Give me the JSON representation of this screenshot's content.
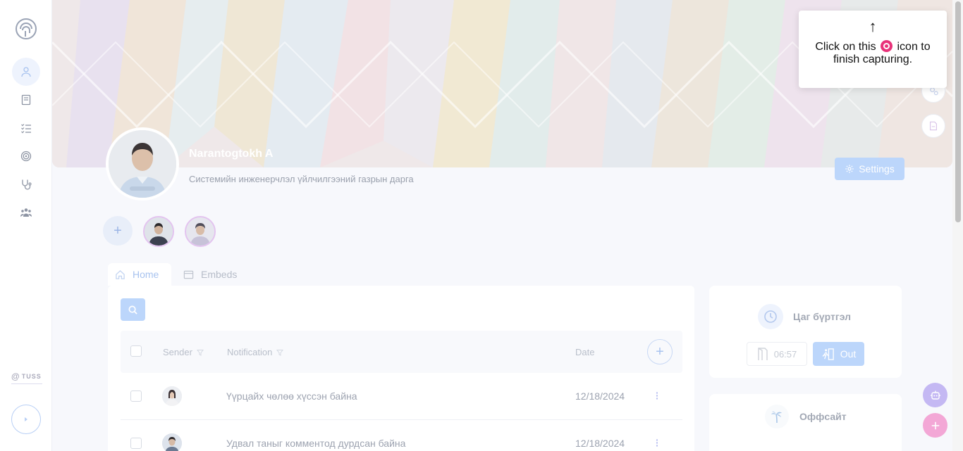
{
  "profile": {
    "name": "Narantogtokh A",
    "job_title": "Системийн инженерчлэл үйлчилгээний газрын дарга",
    "settings_label": "Settings"
  },
  "sidebar": {
    "brand": "TUSS",
    "items": [
      {
        "icon": "user-icon"
      },
      {
        "icon": "book-icon"
      },
      {
        "icon": "checklist-icon"
      },
      {
        "icon": "target-icon"
      },
      {
        "icon": "stethoscope-icon"
      },
      {
        "icon": "team-icon"
      }
    ]
  },
  "tabs": [
    {
      "label": "Home",
      "icon": "home-icon",
      "active": true
    },
    {
      "label": "Embeds",
      "icon": "embed-icon",
      "active": false
    }
  ],
  "table": {
    "columns": {
      "sender": "Sender",
      "notification": "Notification",
      "date": "Date"
    },
    "rows": [
      {
        "text": "Үүрцайх чөлөө хүссэн байна",
        "date": "12/18/2024"
      },
      {
        "text": "Удвал таныг комментод дурдсан байна",
        "date": "12/18/2024"
      }
    ]
  },
  "attendance": {
    "title": "Цаг бүртгэл",
    "time": "06:57",
    "out_label": "Out"
  },
  "offsite": {
    "title": "Оффсайт"
  },
  "tooltip": {
    "arrow": "↑",
    "text_before": "Click on this",
    "text_after": "icon to finish capturing."
  },
  "colors": {
    "accent": "#bcd6fb",
    "record": "#e8337a",
    "fab_purple": "#c4b8f3",
    "fab_pink": "#f3a7d6"
  }
}
